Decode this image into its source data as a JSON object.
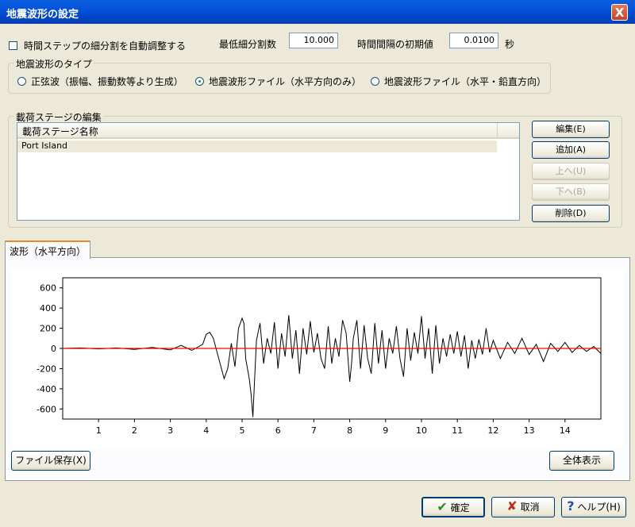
{
  "window": {
    "title": "地震波形の設定",
    "close_label": "X"
  },
  "options": {
    "auto_subdivide_label": "時間ステップの細分割を自動調整する",
    "min_divisions_label": "最低細分割数",
    "min_divisions_value": "10.000",
    "initial_dt_label": "時間間隔の初期値",
    "initial_dt_value": "0.0100",
    "initial_dt_unit": "秒"
  },
  "wave_type": {
    "legend": "地震波形のタイプ",
    "options": [
      "正弦波（振幅、振動数等より生成）",
      "地震波形ファイル（水平方向のみ）",
      "地震波形ファイル（水平・鉛直方向）"
    ],
    "selected_index": 1
  },
  "stage_editor": {
    "legend": "載荷ステージの編集",
    "column_header": "載荷ステージ名称",
    "rows": [
      "Port Island"
    ],
    "buttons": {
      "edit": "編集(E)",
      "add": "追加(A)",
      "up": "上へ(U)",
      "down": "下へ(B)",
      "delete": "削除(D)"
    }
  },
  "tab": {
    "label": "波形（水平方向）"
  },
  "chart_data": {
    "type": "line",
    "title": "",
    "xlabel": "",
    "ylabel": "",
    "xlim": [
      0,
      15
    ],
    "ylim": [
      -700,
      700
    ],
    "xticks": [
      "1",
      "2",
      "3",
      "4",
      "5",
      "6",
      "7",
      "8",
      "9",
      "10",
      "11",
      "12",
      "13",
      "14"
    ],
    "yticks": [
      "600",
      "400",
      "200",
      "0",
      "-200",
      "-400",
      "-600"
    ],
    "grid": false,
    "series": [
      {
        "color": "#000000",
        "x": [
          0,
          0.5,
          1,
          1.5,
          2,
          2.5,
          3,
          3.3,
          3.6,
          3.9,
          4.0,
          4.1,
          4.2,
          4.35,
          4.5,
          4.6,
          4.7,
          4.8,
          4.9,
          5.0,
          5.05,
          5.1,
          5.2,
          5.25,
          5.3,
          5.35,
          5.4,
          5.5,
          5.6,
          5.7,
          5.8,
          5.9,
          6.0,
          6.1,
          6.2,
          6.3,
          6.4,
          6.5,
          6.6,
          6.7,
          6.8,
          6.9,
          7.0,
          7.1,
          7.2,
          7.3,
          7.4,
          7.5,
          7.6,
          7.7,
          7.8,
          7.9,
          8.0,
          8.05,
          8.1,
          8.2,
          8.3,
          8.4,
          8.5,
          8.6,
          8.7,
          8.8,
          8.9,
          9.0,
          9.1,
          9.2,
          9.3,
          9.4,
          9.5,
          9.6,
          9.7,
          9.8,
          9.9,
          10.0,
          10.1,
          10.2,
          10.3,
          10.4,
          10.5,
          10.6,
          10.7,
          10.8,
          10.9,
          11.0,
          11.1,
          11.2,
          11.3,
          11.4,
          11.5,
          11.6,
          11.7,
          11.8,
          11.9,
          12.0,
          12.2,
          12.4,
          12.6,
          12.8,
          13.0,
          13.2,
          13.4,
          13.6,
          13.8,
          14.0,
          14.2,
          14.4,
          14.6,
          14.8,
          15.0
        ],
        "y": [
          0,
          5,
          -5,
          5,
          -10,
          10,
          -15,
          30,
          -20,
          40,
          140,
          160,
          100,
          -100,
          -300,
          -200,
          50,
          -180,
          200,
          300,
          250,
          -100,
          -300,
          -450,
          -680,
          -300,
          80,
          250,
          -150,
          100,
          -50,
          260,
          -200,
          150,
          -80,
          330,
          -100,
          180,
          -250,
          200,
          -60,
          270,
          -40,
          150,
          -100,
          -200,
          220,
          -150,
          100,
          -80,
          280,
          150,
          -330,
          -150,
          100,
          280,
          -200,
          230,
          -100,
          -250,
          250,
          -150,
          180,
          -200,
          100,
          -50,
          220,
          -100,
          -280,
          200,
          -120,
          160,
          -50,
          320,
          -100,
          200,
          -250,
          230,
          -150,
          100,
          -80,
          140,
          -50,
          170,
          -80,
          130,
          -200,
          80,
          -100,
          90,
          -60,
          200,
          -40,
          80,
          -100,
          60,
          -50,
          100,
          -60,
          40,
          -130,
          50,
          -30,
          60,
          -40,
          30,
          -30,
          20,
          -50
        ]
      },
      {
        "color": "#ff0000",
        "x": [
          0,
          15
        ],
        "y": [
          0,
          0
        ]
      }
    ]
  },
  "footer": {
    "file_save": "ファイル保存(X)",
    "show_all": "全体表示",
    "ok": "確定",
    "cancel": "取消",
    "help": "ヘルプ(H)"
  }
}
